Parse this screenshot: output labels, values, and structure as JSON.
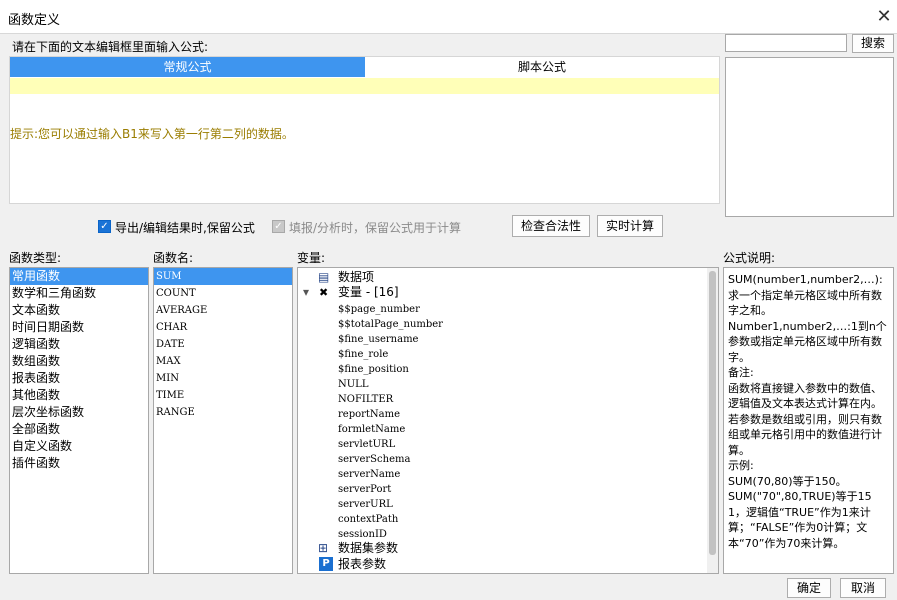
{
  "window": {
    "title": "函数定义",
    "close_glyph": "✕"
  },
  "editor": {
    "label": "请在下面的文本编辑框里面输入公式:",
    "tabs": [
      "常规公式",
      "脚本公式"
    ],
    "hint": "提示:您可以通过输入B1来写入第一行第二列的数据。"
  },
  "options": {
    "keep_formula_label": "导出/编辑结果时,保留公式",
    "keep_formula_checked": true,
    "fill_formula_label": "填报/分析时，保留公式用于计算",
    "fill_formula_checked": true,
    "check_button": "检查合法性",
    "realtime_button": "实时计算"
  },
  "search": {
    "value": "",
    "button": "搜索"
  },
  "function_types": {
    "label": "函数类型:",
    "items": [
      "常用函数",
      "数学和三角函数",
      "文本函数",
      "时间日期函数",
      "逻辑函数",
      "数组函数",
      "报表函数",
      "其他函数",
      "层次坐标函数",
      "全部函数",
      "自定义函数",
      "插件函数"
    ],
    "selected": 0
  },
  "function_names": {
    "label": "函数名:",
    "items": [
      "SUM",
      "COUNT",
      "AVERAGE",
      "CHAR",
      "DATE",
      "MAX",
      "MIN",
      "TIME",
      "RANGE"
    ],
    "selected": 0
  },
  "variables": {
    "label": "变量:",
    "data_items": "数据项",
    "variables_node": "变量 - [16]",
    "variable_list": [
      "$$page_number",
      "$$totalPage_number",
      "$fine_username",
      "$fine_role",
      "$fine_position",
      "NULL",
      "NOFILTER",
      "reportName",
      "formletName",
      "servletURL",
      "serverSchema",
      "serverName",
      "serverPort",
      "serverURL",
      "contextPath",
      "sessionID"
    ],
    "dataset_params": "数据集参数",
    "report_params": "报表参数",
    "icon_p": "P",
    "icon_collapse": "▾",
    "icon_x": "✖",
    "icon_box": "▤",
    "icon_ds": "⊞"
  },
  "description": {
    "label": "公式说明:",
    "text": "SUM(number1,number2,…):求一个指定单元格区域中所有数字之和。\nNumber1,number2,…:1到n个参数或指定单元格区域中所有数字。\n备注:\n函数将直接键入参数中的数值、逻辑值及文本表达式计算在内。若参数是数组或引用，则只有数组或单元格引用中的数值进行计算。\n示例:\nSUM(70,80)等于150。\nSUM(\"70\",80,TRUE)等于151，逻辑值“TRUE”作为1来计算；“FALSE”作为0计算；文本“70”作为70来计算。"
  },
  "footer": {
    "ok": "确定",
    "cancel": "取消"
  }
}
